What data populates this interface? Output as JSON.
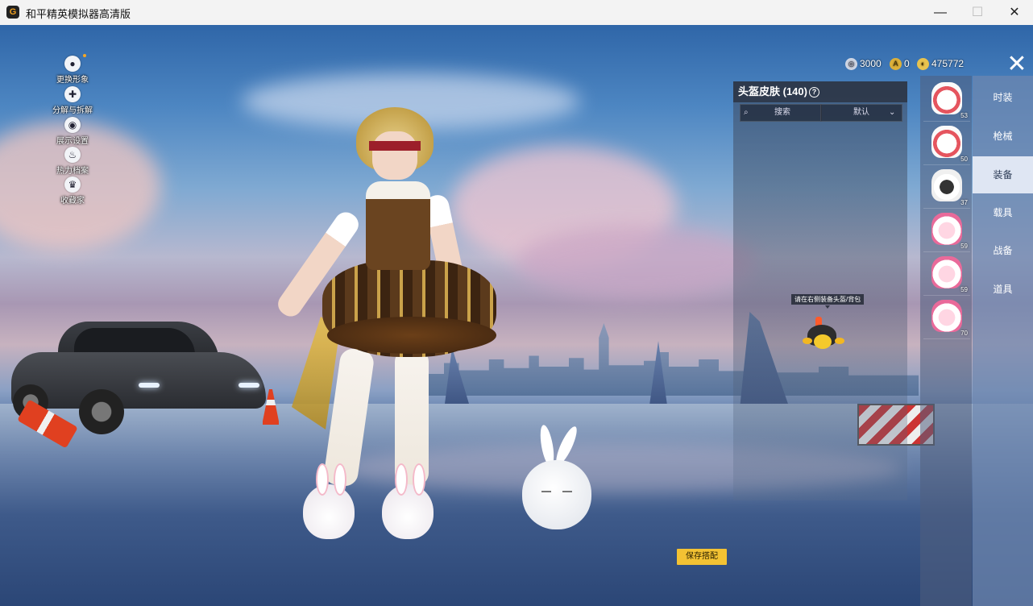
{
  "window": {
    "title": "和平精英模拟器高清版",
    "min_label": "—",
    "max_label": "☐",
    "close_label": "✕"
  },
  "side_menu": [
    {
      "label": "更换形象",
      "icon": "person-icon",
      "glyph": "●"
    },
    {
      "label": "分解与拆解",
      "icon": "puzzle-icon",
      "glyph": "✚"
    },
    {
      "label": "展示设置",
      "icon": "eye-icon",
      "glyph": "◉"
    },
    {
      "label": "热力档案",
      "icon": "fire-icon",
      "glyph": "♨"
    },
    {
      "label": "收藏家",
      "icon": "crown-icon",
      "glyph": "♛"
    }
  ],
  "currency": [
    {
      "icon": "silver-coin-icon",
      "glyph": "◎",
      "value": "3000"
    },
    {
      "icon": "gold-token-icon",
      "glyph": "A",
      "value": "0"
    },
    {
      "icon": "gold-coin-icon",
      "glyph": "◐",
      "value": "475772"
    }
  ],
  "close_label": "✕",
  "skin_panel": {
    "title": "头盔皮肤 (140)",
    "help": "?",
    "search_icon": "⌕",
    "search_placeholder": "搜索",
    "sort_value": "默认",
    "sort_chevron": "⌄",
    "tooltip": "请在右侧装备头盔/背包"
  },
  "items": [
    {
      "count": "53",
      "icon": "bunny-helmet-icon",
      "style": "red"
    },
    {
      "count": "50",
      "icon": "bunny-helmet-icon",
      "style": "red"
    },
    {
      "count": "37",
      "icon": "bunny-helmet-icon",
      "style": "dark"
    },
    {
      "count": "59",
      "icon": "bunny-backpack-icon",
      "style": "pink"
    },
    {
      "count": "59",
      "icon": "bunny-backpack-icon",
      "style": "pink"
    },
    {
      "count": "70",
      "icon": "bunny-backpack-icon",
      "style": "pink"
    }
  ],
  "categories": [
    {
      "label": "时装",
      "active": false
    },
    {
      "label": "枪械",
      "active": false
    },
    {
      "label": "装备",
      "active": true
    },
    {
      "label": "载具",
      "active": false
    },
    {
      "label": "战备",
      "active": false
    },
    {
      "label": "道具",
      "active": false
    }
  ],
  "save_button": "保存搭配",
  "colors": {
    "accent": "#f3c233",
    "active_tab": "#dfe6f3"
  }
}
